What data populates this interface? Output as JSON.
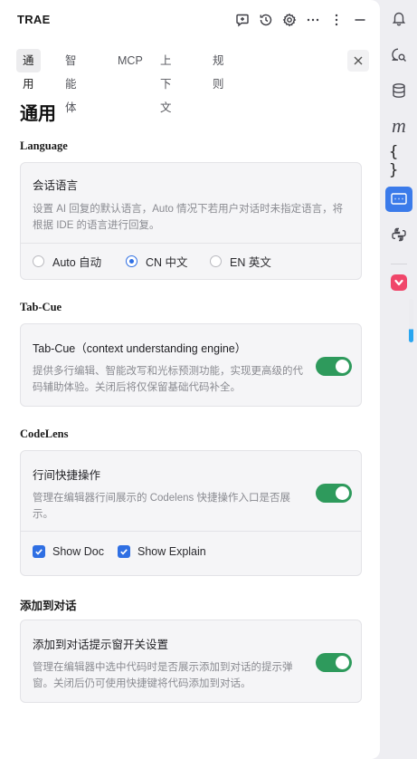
{
  "header": {
    "app_title": "TRAE"
  },
  "tabs": [
    {
      "label": "通用"
    },
    {
      "label": "智能体"
    },
    {
      "label": "MCP"
    },
    {
      "label": "上下文"
    },
    {
      "label": "规则"
    }
  ],
  "page": {
    "title": "通用"
  },
  "language": {
    "heading": "Language",
    "title": "会话语言",
    "description": "设置 AI 回复的默认语言，Auto 情况下若用户对话时未指定语言，将根据 IDE 的语言进行回复。",
    "options": [
      {
        "label": "Auto 自动",
        "selected": false
      },
      {
        "label": "CN 中文",
        "selected": true
      },
      {
        "label": "EN 英文",
        "selected": false
      }
    ]
  },
  "tabcue": {
    "heading": "Tab-Cue",
    "title": "Tab-Cue（context understanding engine）",
    "description": "提供多行编辑、智能改写和光标预测功能，实现更高级的代码辅助体验。关闭后将仅保留基础代码补全。",
    "enabled": true
  },
  "codelens": {
    "heading": "CodeLens",
    "title": "行间快捷操作",
    "description": "管理在编辑器行间展示的 Codelens 快捷操作入口是否展示。",
    "enabled": true,
    "checkboxes": [
      {
        "label": "Show Doc",
        "checked": true
      },
      {
        "label": "Show Explain",
        "checked": true
      }
    ]
  },
  "add_to_chat": {
    "heading": "添加到对话",
    "title": "添加到对话提示窗开关设置",
    "description": "管理在编辑器中选中代码时是否展示添加到对话的提示弹窗。关闭后仍可使用快捷键将代码添加到对话。",
    "enabled": true
  },
  "rail": {
    "icons": [
      "bell-icon",
      "chat-search-icon",
      "database-icon",
      "m-extension-icon",
      "braces-icon",
      "panel-icon",
      "python-icon",
      "extension-icon"
    ],
    "braces_glyph": "{ }",
    "m_glyph": "m"
  },
  "colors": {
    "accent": "#2f6fe3",
    "toggle_on": "#2e9a5c",
    "rail_active": "#3b7bea"
  }
}
